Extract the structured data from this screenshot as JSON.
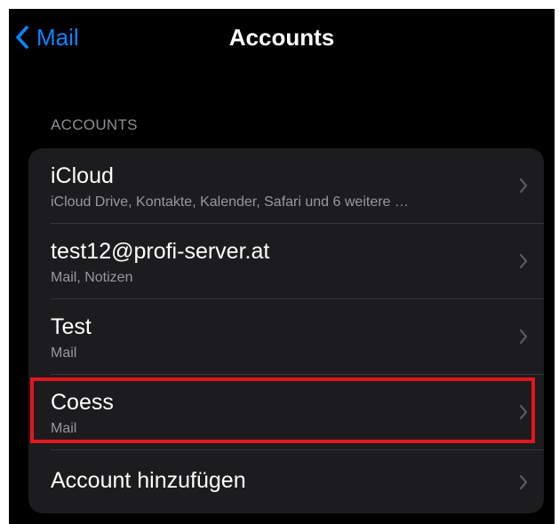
{
  "navbar": {
    "back_label": "Mail",
    "title": "Accounts"
  },
  "section": {
    "header": "ACCOUNTS"
  },
  "accounts": [
    {
      "title": "iCloud",
      "subtitle": "iCloud Drive, Kontakte, Kalender, Safari und 6 weitere …"
    },
    {
      "title": "test12@profi-server.at",
      "subtitle": "Mail, Notizen"
    },
    {
      "title": "Test",
      "subtitle": "Mail"
    },
    {
      "title": "Coess",
      "subtitle": "Mail"
    }
  ],
  "add_account": {
    "label": "Account hinzufügen"
  },
  "icons": {
    "back": "chevron-left-icon",
    "disclosure": "chevron-right-icon"
  },
  "colors": {
    "background": "#000000",
    "group_background": "#1c1c1e",
    "accent": "#0a84ff",
    "secondary_text": "#98989f",
    "separator": "#38383a",
    "highlight": "#e3151e"
  }
}
